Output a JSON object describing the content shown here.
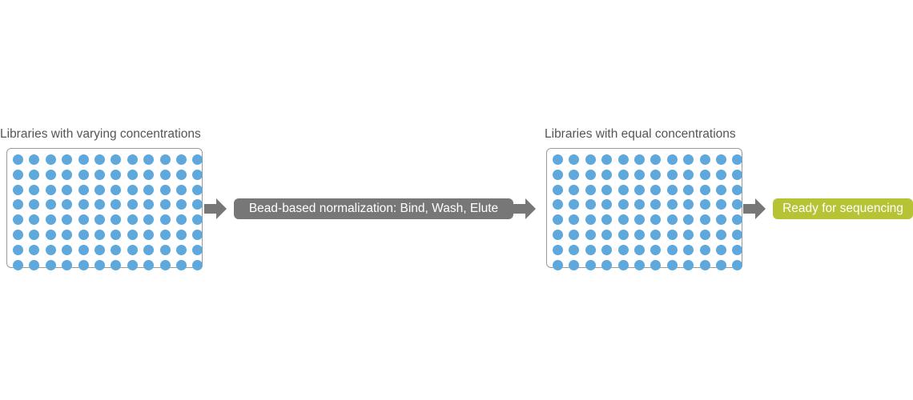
{
  "diagram": {
    "source_plate": {
      "label": "Libraries with varying concentrations",
      "rows": 8,
      "columns": 12
    },
    "process_step": {
      "label": "Bead-based normalization: Bind, Wash, Elute",
      "color": "#777777"
    },
    "result_plate": {
      "label": "Libraries with equal concentrations",
      "rows": 8,
      "columns": 12
    },
    "final_step": {
      "label": "Ready for sequencing",
      "color": "#b5c335"
    },
    "colors": {
      "well": "#5ea8dc",
      "arrow": "#777777",
      "plate_border": "#9a9a9a",
      "label_text": "#555555"
    }
  }
}
